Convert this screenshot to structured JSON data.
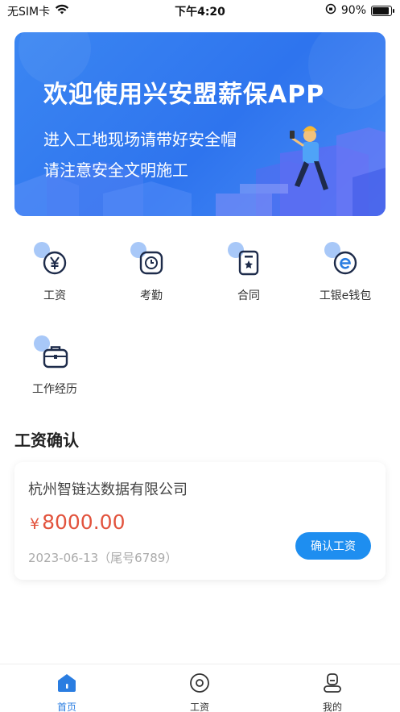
{
  "status_bar": {
    "carrier": "无SIM卡",
    "time": "下午4:20",
    "battery": "90%",
    "battery_level": 0.9
  },
  "banner": {
    "title": "欢迎使用兴安盟薪保APP",
    "line1": "进入工地现场请带好安全帽",
    "line2": "请注意安全文明施工"
  },
  "quick_actions": [
    {
      "label": "工资",
      "icon": "yen-circle-icon"
    },
    {
      "label": "考勤",
      "icon": "clock-icon"
    },
    {
      "label": "合同",
      "icon": "contract-icon"
    },
    {
      "label": "工银e钱包",
      "icon": "e-wallet-icon"
    },
    {
      "label": "工作经历",
      "icon": "briefcase-icon"
    }
  ],
  "salary_confirm": {
    "section_title": "工资确认",
    "company": "杭州智链达数据有限公司",
    "currency": "¥",
    "amount": "8000.00",
    "date": "2023-06-13（尾号6789）",
    "confirm_label": "确认工资"
  },
  "tab_bar": {
    "items": [
      {
        "label": "首页",
        "icon": "home-icon",
        "active": true
      },
      {
        "label": "工资",
        "icon": "salary-icon",
        "active": false
      },
      {
        "label": "我的",
        "icon": "profile-icon",
        "active": false
      }
    ]
  },
  "colors": {
    "primary": "#2a7de1",
    "banner_blue": "#2e74ee",
    "amount_red": "#e2533d",
    "button_blue": "#1e8ef0"
  }
}
